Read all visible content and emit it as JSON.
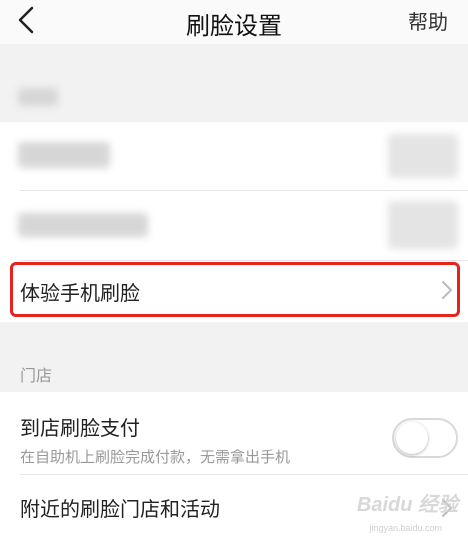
{
  "header": {
    "title": "刷脸设置",
    "help_label": "帮助"
  },
  "sections": {
    "store_label": "门店"
  },
  "rows": {
    "experience_label": "体验手机刷脸",
    "store_pay_label": "到店刷脸支付",
    "store_pay_desc": "在自助机上刷脸完成付款，无需拿出手机",
    "nearby_label": "附近的刷脸门店和活动"
  },
  "toggles": {
    "store_pay_enabled": false
  },
  "watermark": {
    "text": "Baidu 经验",
    "sub": "jingyan.baidu.com"
  },
  "colors": {
    "highlight": "#e8221c",
    "background": "#f2f2f2"
  },
  "icons": {
    "back": "chevron-left-icon",
    "row_arrow": "chevron-right-icon"
  }
}
